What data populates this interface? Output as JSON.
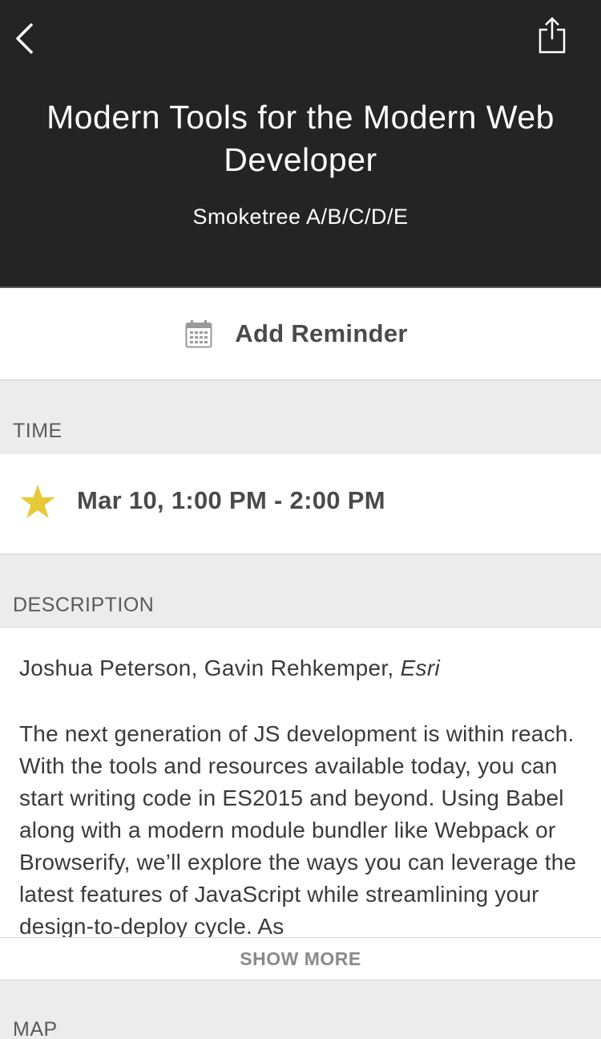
{
  "header": {
    "title": "Modern Tools for the Modern Web Developer",
    "room": "Smoketree A/B/C/D/E",
    "back_icon": "chevron-left-icon",
    "share_icon": "share-icon",
    "background": "#242424"
  },
  "reminder": {
    "label": "Add Reminder",
    "icon": "calendar-icon"
  },
  "time_section": {
    "label": "TIME",
    "value": "Mar 10, 1:00 PM - 2:00 PM",
    "star_icon": "star-icon",
    "star_color": "#e8c93a"
  },
  "description_section": {
    "label": "DESCRIPTION",
    "speakers": "Joshua Peterson, Gavin Rehkemper, ",
    "organization": "Esri",
    "text": "The next generation of JS development is within reach. With the tools and resources available today, you can start writing code in ES2015 and beyond. Using Babel along with a modern module bundler like Webpack or Browserify, we’ll explore the ways you can leverage the latest features of JavaScript while streamlining your design-to-deploy cycle. As",
    "show_more": "SHOW MORE"
  },
  "map_section": {
    "label": "MAP"
  }
}
